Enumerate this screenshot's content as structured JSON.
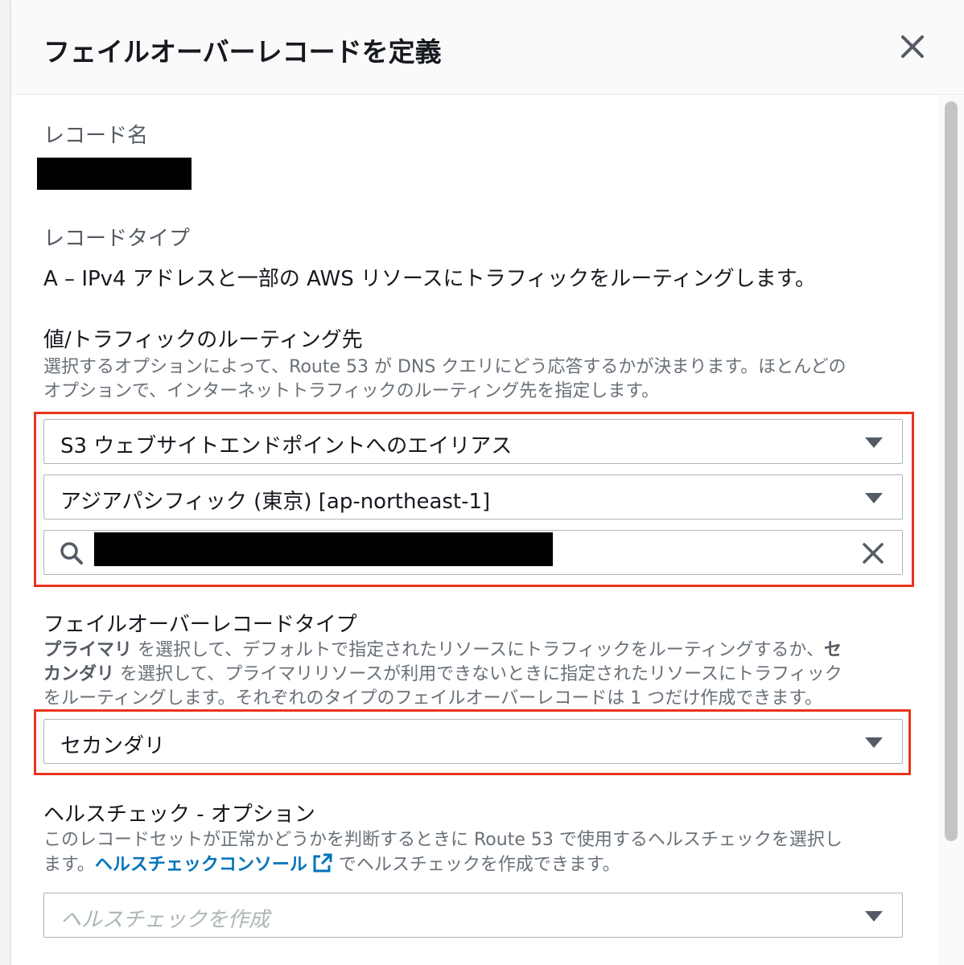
{
  "modal": {
    "title": "フェイルオーバーレコードを定義"
  },
  "record_name": {
    "label": "レコード名"
  },
  "record_type": {
    "label": "レコードタイプ",
    "value": "A – IPv4 アドレスと一部の AWS リソースにトラフィックをルーティングします。"
  },
  "routing": {
    "label": "値/トラフィックのルーティング先",
    "desc_line1": "選択するオプションによって、Route 53 が DNS クエリにどう応答するかが決まります。ほとんどの",
    "desc_line2": "オプションで、インターネットトラフィックのルーティング先を指定します。",
    "endpoint_select": "S3 ウェブサイトエンドポイントへのエイリアス",
    "region_select": "アジアパシフィック (東京) [ap-northeast-1]"
  },
  "failover": {
    "label": "フェイルオーバーレコードタイプ",
    "desc_primary": "プライマリ",
    "desc_part1": " を選択して、デフォルトで指定されたリソースにトラフィックをルーティングするか、",
    "desc_secondary_a": "セ",
    "desc_secondary_b": "カンダリ",
    "desc_part2": " を選択して、プライマリリソースが利用できないときに指定されたリソースにトラフィック",
    "desc_line3": "をルーティングします。それぞれのタイプのフェイルオーバーレコードは 1 つだけ作成できます。",
    "selected": "セカンダリ"
  },
  "health_check": {
    "label": "ヘルスチェック - オプション",
    "desc_line1": "このレコードセットが正常かどうかを判断するときに Route 53 で使用するヘルスチェックを選択し",
    "desc_line2a": "ます。",
    "link_text": "ヘルスチェックコンソール",
    "desc_line2b": " でヘルスチェックを作成できます。",
    "placeholder": "ヘルスチェックを作成"
  },
  "colors": {
    "highlight": "#e8341c",
    "link": "#0073bb"
  }
}
